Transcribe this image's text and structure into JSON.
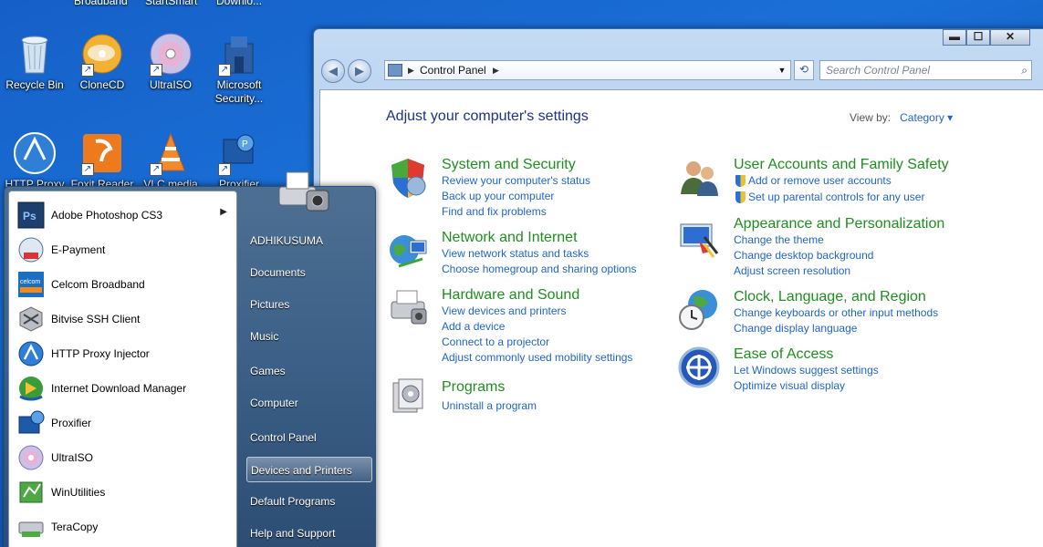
{
  "desktop": {
    "top_partial_labels": [
      "Broadband",
      "StartSmart",
      "Downlo..."
    ],
    "icons": [
      {
        "label": "Recycle Bin",
        "icon": "recycle-bin-icon"
      },
      {
        "label": "CloneCD",
        "icon": "clonecd-icon"
      },
      {
        "label": "UltraISO",
        "icon": "ultraiso-icon"
      },
      {
        "label": "Microsoft Security...",
        "icon": "microsoft-security-icon"
      },
      {
        "label": "HTTP Proxy",
        "icon": "http-proxy-icon"
      },
      {
        "label": "Foxit Reader",
        "icon": "foxit-reader-icon"
      },
      {
        "label": "VLC media",
        "icon": "vlc-icon"
      },
      {
        "label": "Proxifier",
        "icon": "proxifier-icon"
      }
    ]
  },
  "window": {
    "controls": {
      "minimize": "▬",
      "maximize": "☐",
      "close": "✕"
    },
    "address": {
      "path": "Control Panel"
    },
    "search_placeholder": "Search Control Panel",
    "title": "Adjust your computer's settings",
    "view_by_label": "View by:",
    "view_by_value": "Category",
    "categories": [
      {
        "heading": "System and Security",
        "icon": "shield-icon",
        "links": [
          "Review your computer's status",
          "Back up your computer",
          "Find and fix problems"
        ]
      },
      {
        "heading": "Network and Internet",
        "icon": "network-globe-icon",
        "links": [
          "View network status and tasks",
          "Choose homegroup and sharing options"
        ]
      },
      {
        "heading": "Hardware and Sound",
        "icon": "printer-icon",
        "links": [
          "View devices and printers",
          "Add a device",
          "Connect to a projector",
          "Adjust commonly used mobility settings"
        ]
      },
      {
        "heading": "Programs",
        "icon": "programs-icon",
        "links": [
          "Uninstall a program"
        ]
      },
      {
        "heading": "User Accounts and Family Safety",
        "icon": "users-icon",
        "links": [
          "Add or remove user accounts",
          "Set up parental controls for any user"
        ]
      },
      {
        "heading": "Appearance and Personalization",
        "icon": "monitor-paint-icon",
        "links": [
          "Change the theme",
          "Change desktop background",
          "Adjust screen resolution"
        ]
      },
      {
        "heading": "Clock, Language, and Region",
        "icon": "clock-globe-icon",
        "links": [
          "Change keyboards or other input methods",
          "Change display language"
        ]
      },
      {
        "heading": "Ease of Access",
        "icon": "ease-of-access-icon",
        "links": [
          "Let Windows suggest settings",
          "Optimize visual display"
        ]
      }
    ]
  },
  "start_menu": {
    "programs": [
      {
        "label": "Adobe Photoshop CS3",
        "icon": "photoshop-icon",
        "has_submenu": true
      },
      {
        "label": "E-Payment",
        "icon": "e-payment-icon"
      },
      {
        "label": "Celcom Broadband",
        "icon": "celcom-icon"
      },
      {
        "label": "Bitvise SSH Client",
        "icon": "bitvise-icon"
      },
      {
        "label": "HTTP Proxy Injector",
        "icon": "http-proxy-icon"
      },
      {
        "label": "Internet Download Manager",
        "icon": "idm-icon"
      },
      {
        "label": "Proxifier",
        "icon": "proxifier-icon"
      },
      {
        "label": "UltraISO",
        "icon": "ultraiso-icon"
      },
      {
        "label": "WinUtilities",
        "icon": "winutilities-icon"
      },
      {
        "label": "TeraCopy",
        "icon": "teracopy-icon"
      }
    ],
    "right_items": [
      "ADHIKUSUMA",
      "Documents",
      "Pictures",
      "Music",
      "Games",
      "Computer",
      "Control Panel",
      "Devices and Printers",
      "Default Programs",
      "Help and Support"
    ],
    "highlighted": "Devices and Printers"
  }
}
